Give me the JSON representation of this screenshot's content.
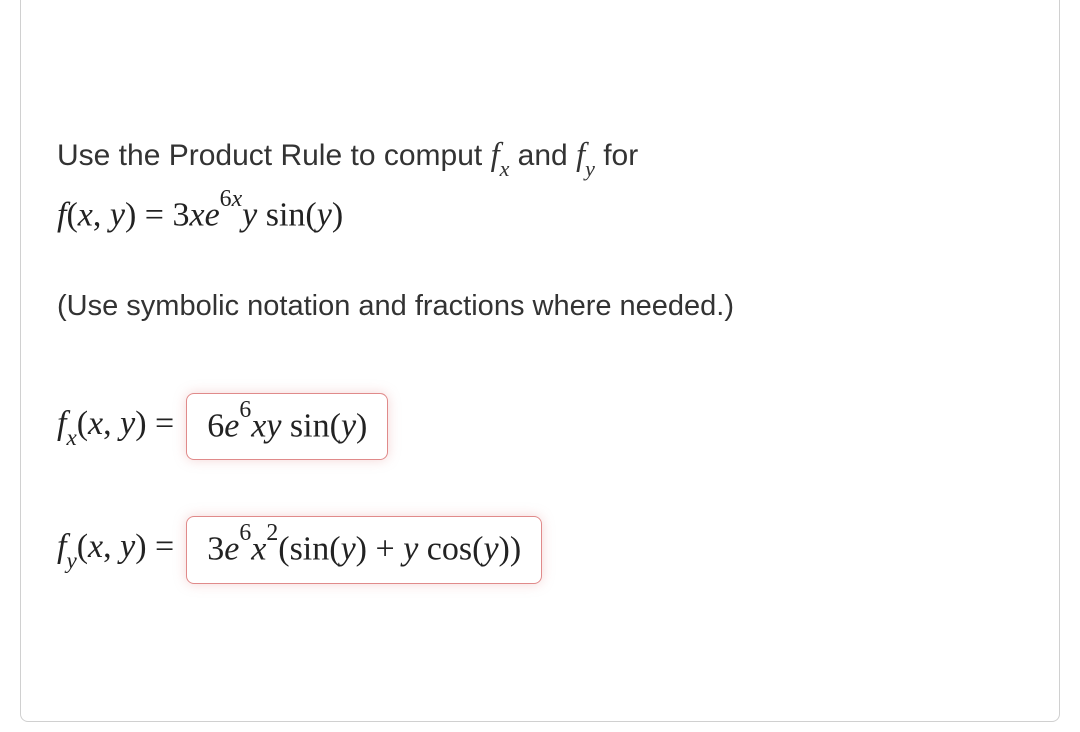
{
  "problem": {
    "prompt_part1": "Use the Product Rule to comput ",
    "fx_symbol_base": "f",
    "fx_symbol_sub": "x",
    "prompt_part2": " and ",
    "fy_symbol_base": "f",
    "fy_symbol_sub": "y",
    "prompt_part3": " for",
    "function_lhs_f": "f",
    "function_lhs_open": "(",
    "function_lhs_x": "x",
    "function_lhs_comma": ", ",
    "function_lhs_y": "y",
    "function_lhs_close": ") = ",
    "function_rhs_coef": "3",
    "function_rhs_x": "x",
    "function_rhs_e": "e",
    "function_rhs_exp_6": "6",
    "function_rhs_exp_x": "x",
    "function_rhs_y": "y",
    "function_rhs_sin": " sin",
    "function_rhs_sin_open": "(",
    "function_rhs_sin_y": "y",
    "function_rhs_sin_close": ")"
  },
  "hint": "(Use symbolic notation and fractions where needed.)",
  "answers": {
    "fx": {
      "label_f": "f",
      "label_sub": "x",
      "label_open": "(",
      "label_x": "x",
      "label_comma": ", ",
      "label_y": "y",
      "label_close": ") =",
      "box_coef": "6",
      "box_e": "e",
      "box_sup": "6",
      "box_xy": "xy",
      "box_sin": " sin",
      "box_sin_open": "(",
      "box_sin_y": "y",
      "box_sin_close": ")"
    },
    "fy": {
      "label_f": "f",
      "label_sub": "y",
      "label_open": "(",
      "label_x": "x",
      "label_comma": ", ",
      "label_y": "y",
      "label_close": ") =",
      "box_coef": "3",
      "box_e": "e",
      "box_sup": "6",
      "box_x": "x",
      "box_xsup": "2",
      "box_open": "(",
      "box_sin": "sin",
      "box_sin_open": "(",
      "box_sin_y": "y",
      "box_sin_close": ")",
      "box_plus": " + ",
      "box_y": "y",
      "box_cos": " cos",
      "box_cos_open": "(",
      "box_cos_y": "y",
      "box_cos_close": ")",
      "box_close": ")"
    }
  }
}
